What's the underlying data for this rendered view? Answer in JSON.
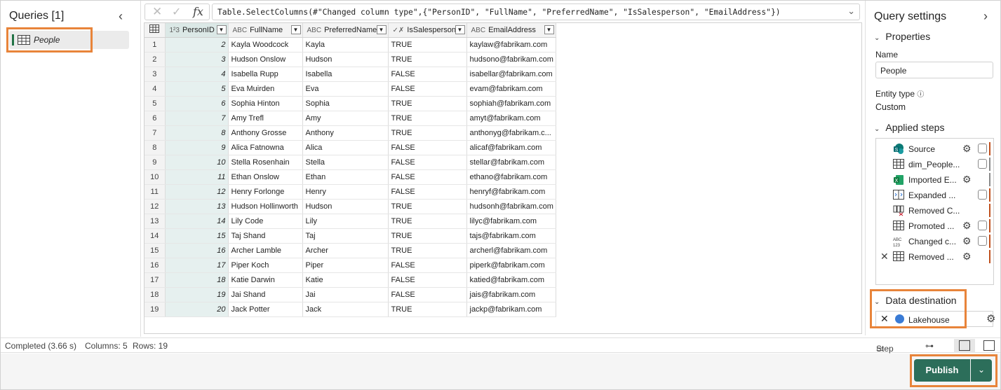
{
  "queries": {
    "title": "Queries [1]",
    "items": [
      {
        "label": "People"
      }
    ]
  },
  "formula": {
    "text": "Table.SelectColumns(#\"Changed column type\",{\"PersonID\", \"FullName\", \"PreferredName\", \"IsSalesperson\", \"EmailAddress\"})"
  },
  "grid": {
    "columns": [
      {
        "name": "PersonID",
        "type": "1²3"
      },
      {
        "name": "FullName",
        "type": "ABC"
      },
      {
        "name": "PreferredName",
        "type": "ABC"
      },
      {
        "name": "IsSalesperson",
        "type": "✓✗"
      },
      {
        "name": "EmailAddress",
        "type": "ABC"
      }
    ],
    "rows": [
      [
        "1",
        "2",
        "Kayla Woodcock",
        "Kayla",
        "TRUE",
        "kaylaw@fabrikam.com"
      ],
      [
        "2",
        "3",
        "Hudson Onslow",
        "Hudson",
        "TRUE",
        "hudsono@fabrikam.com"
      ],
      [
        "3",
        "4",
        "Isabella Rupp",
        "Isabella",
        "FALSE",
        "isabellar@fabrikam.com"
      ],
      [
        "4",
        "5",
        "Eva Muirden",
        "Eva",
        "FALSE",
        "evam@fabrikam.com"
      ],
      [
        "5",
        "6",
        "Sophia Hinton",
        "Sophia",
        "TRUE",
        "sophiah@fabrikam.com"
      ],
      [
        "6",
        "7",
        "Amy Trefl",
        "Amy",
        "TRUE",
        "amyt@fabrikam.com"
      ],
      [
        "7",
        "8",
        "Anthony Grosse",
        "Anthony",
        "TRUE",
        "anthonyg@fabrikam.c..."
      ],
      [
        "8",
        "9",
        "Alica Fatnowna",
        "Alica",
        "FALSE",
        "alicaf@fabrikam.com"
      ],
      [
        "9",
        "10",
        "Stella Rosenhain",
        "Stella",
        "FALSE",
        "stellar@fabrikam.com"
      ],
      [
        "10",
        "11",
        "Ethan Onslow",
        "Ethan",
        "FALSE",
        "ethano@fabrikam.com"
      ],
      [
        "11",
        "12",
        "Henry Forlonge",
        "Henry",
        "FALSE",
        "henryf@fabrikam.com"
      ],
      [
        "12",
        "13",
        "Hudson Hollinworth",
        "Hudson",
        "TRUE",
        "hudsonh@fabrikam.com"
      ],
      [
        "13",
        "14",
        "Lily Code",
        "Lily",
        "TRUE",
        "lilyc@fabrikam.com"
      ],
      [
        "14",
        "15",
        "Taj Shand",
        "Taj",
        "TRUE",
        "tajs@fabrikam.com"
      ],
      [
        "15",
        "16",
        "Archer Lamble",
        "Archer",
        "TRUE",
        "archerl@fabrikam.com"
      ],
      [
        "16",
        "17",
        "Piper Koch",
        "Piper",
        "FALSE",
        "piperk@fabrikam.com"
      ],
      [
        "17",
        "18",
        "Katie Darwin",
        "Katie",
        "FALSE",
        "katied@fabrikam.com"
      ],
      [
        "18",
        "19",
        "Jai Shand",
        "Jai",
        "FALSE",
        "jais@fabrikam.com"
      ],
      [
        "19",
        "20",
        "Jack Potter",
        "Jack",
        "TRUE",
        "jackp@fabrikam.com"
      ]
    ]
  },
  "settings": {
    "title": "Query settings",
    "properties_label": "Properties",
    "name_label": "Name",
    "name_value": "People",
    "entity_type_label": "Entity type",
    "entity_type_value": "Custom",
    "applied_steps_label": "Applied steps",
    "steps": [
      {
        "label": "Source",
        "icon": "sharepoint-icon",
        "gear": true,
        "cyl": true,
        "ind": "#c0501e"
      },
      {
        "label": "dim_People...",
        "icon": "table-icon",
        "gear": false,
        "cyl": true,
        "ind": "#8a8a8a"
      },
      {
        "label": "Imported E...",
        "icon": "excel-icon",
        "gear": true,
        "cyl": false,
        "ind": "#8a8a8a"
      },
      {
        "label": "Expanded ...",
        "icon": "expand-icon",
        "gear": false,
        "cyl": true,
        "ind": "#c0501e"
      },
      {
        "label": "Removed C...",
        "icon": "remove-columns-icon",
        "gear": false,
        "cyl": false,
        "ind": "#c0501e"
      },
      {
        "label": "Promoted ...",
        "icon": "table-icon",
        "gear": true,
        "cyl": true,
        "ind": "#c0501e"
      },
      {
        "label": "Changed c...",
        "icon": "type-abc123-icon",
        "gear": true,
        "cyl": true,
        "ind": "#c0501e"
      },
      {
        "label": "Removed ...",
        "icon": "table-icon",
        "gear": true,
        "cyl": false,
        "ind": "#c0501e"
      }
    ],
    "data_destination_label": "Data destination",
    "destination": "Lakehouse"
  },
  "status": {
    "completed": "Completed (3.66 s)",
    "columns": "Columns: 5",
    "rows": "Rows: 19",
    "step_label": "Step"
  },
  "publish": {
    "label": "Publish"
  },
  "colors": {
    "accent": "#2c6e5a",
    "highlight": "#e8843a"
  }
}
